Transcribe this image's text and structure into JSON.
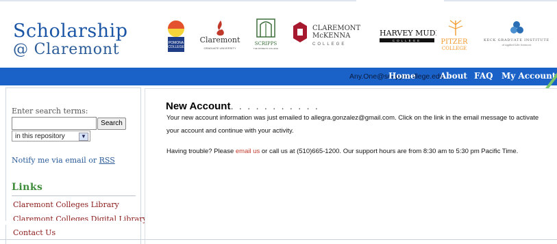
{
  "header": {
    "logo_line1": "Scholarship",
    "logo_line2": "@ Claremont",
    "colleges": [
      {
        "name": "Pomona College",
        "label": "POMONA COLLEGE"
      },
      {
        "name": "Claremont Graduate University",
        "label": "Claremont",
        "sub": "GRADUATE UNIVERSITY"
      },
      {
        "name": "Scripps College",
        "label": "SCRIPPS",
        "sub": "THE WOMEN'S COLLEGE"
      },
      {
        "name": "Claremont McKenna College",
        "label1": "CLAREMONT",
        "label2": "McKENNA",
        "sub": "COLLEGE"
      },
      {
        "name": "Harvey Mudd College",
        "label": "HARVEY MUDD",
        "sub": "COLLEGE"
      },
      {
        "name": "Pitzer College",
        "label1": "PITZER",
        "label2": "COLLEGE"
      },
      {
        "name": "Keck Graduate Institute",
        "label": "KECK GRADUATE INSTITUTE",
        "sub": "of Applied Life Sciences"
      }
    ]
  },
  "navbar": {
    "user_email": "Any.One@scrippscollege.edu",
    "items": [
      "Home",
      "About",
      "FAQ",
      "My Account"
    ]
  },
  "sidebar": {
    "search_label": "Enter search terms:",
    "search_value": "",
    "search_button": "Search",
    "scope_selected": "in this repository",
    "notify_prefix": "Notify me via email or ",
    "notify_rss": "RSS",
    "links_title": "Links",
    "links": [
      "Claremont Colleges Library",
      "Claremont Colleges Digital Library",
      "Contact Us"
    ]
  },
  "main": {
    "title": "New Account",
    "title_dots": ". . . . . . . . . . .",
    "para1": "Your new account information was just emailed to allegra.gonzalez@gmail.com. Click on the link in the email message to activate your account and continue with your activity.",
    "para2_before": "Having trouble? Please ",
    "para2_link": "email us",
    "para2_after": " or call us at (510)665-1200. Our support hours are from 8:30 am to 5:30 pm Pacific Time."
  },
  "colors": {
    "navbar": "#1a62c7",
    "logo_blue": "#1b55a5",
    "links_green": "#3e8b3a",
    "link_red": "#8b1a1a",
    "check_green": "#7ac86a"
  }
}
